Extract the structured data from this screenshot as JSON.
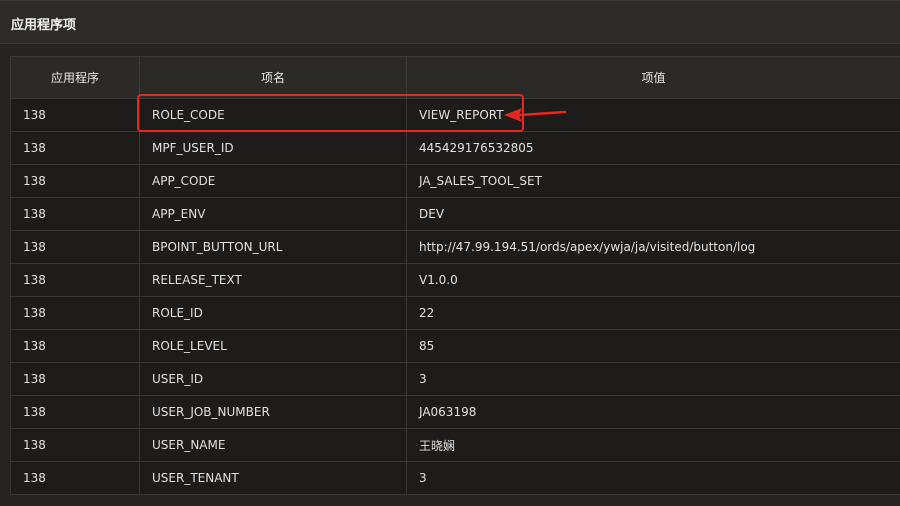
{
  "region": {
    "title": "应用程序项"
  },
  "table": {
    "headers": [
      "应用程序",
      "项名",
      "项值"
    ],
    "rows": [
      {
        "app": "138",
        "name": "ROLE_CODE",
        "value": "VIEW_REPORT"
      },
      {
        "app": "138",
        "name": "MPF_USER_ID",
        "value": "445429176532805"
      },
      {
        "app": "138",
        "name": "APP_CODE",
        "value": "JA_SALES_TOOL_SET"
      },
      {
        "app": "138",
        "name": "APP_ENV",
        "value": "DEV"
      },
      {
        "app": "138",
        "name": "BPOINT_BUTTON_URL",
        "value": "http://47.99.194.51/ords/apex/ywja/ja/visited/button/log"
      },
      {
        "app": "138",
        "name": "RELEASE_TEXT",
        "value": "V1.0.0"
      },
      {
        "app": "138",
        "name": "ROLE_ID",
        "value": "22"
      },
      {
        "app": "138",
        "name": "ROLE_LEVEL",
        "value": "85"
      },
      {
        "app": "138",
        "name": "USER_ID",
        "value": "3"
      },
      {
        "app": "138",
        "name": "USER_JOB_NUMBER",
        "value": "JA063198"
      },
      {
        "app": "138",
        "name": "USER_NAME",
        "value": "王晓娴"
      },
      {
        "app": "138",
        "name": "USER_TENANT",
        "value": "3"
      }
    ]
  },
  "annotation": {
    "color": "#e8261f",
    "highlighted_row": "ROLE_CODE"
  }
}
